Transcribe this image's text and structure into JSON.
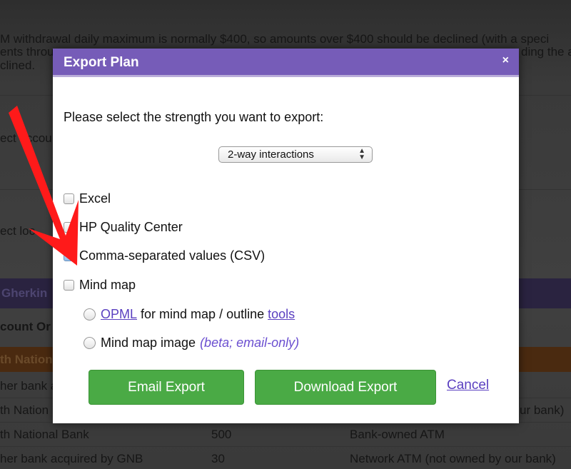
{
  "background": {
    "lines": [
      "M withdrawal daily maximum is normally $400, so amounts over $400 should be declined (with a speci",
      "ents throug",
      "ding the a",
      "clined.",
      "ect accou",
      "ect loc",
      "Gherkin",
      "count Or",
      "th Nation",
      "her bank a",
      "th Nation",
      "ur bank)"
    ],
    "rows": [
      {
        "bank": "th National Bank",
        "amount": "500",
        "atm": "Bank-owned ATM"
      },
      {
        "bank": "her bank acquired by GNB",
        "amount": "30",
        "atm": "Network ATM (not owned by our bank)"
      }
    ]
  },
  "modal": {
    "title": "Export Plan",
    "close": "×",
    "prompt": "Please select the strength you want to export:",
    "strength": {
      "selected": "2-way interactions"
    },
    "options": [
      {
        "label": "Excel",
        "checked": false
      },
      {
        "label": "HP Quality Center",
        "checked": false
      },
      {
        "label": "Comma-separated values (CSV)",
        "checked": true
      },
      {
        "label": "Mind map",
        "checked": false
      }
    ],
    "mindmap": {
      "opml_link": "OPML",
      "opml_text": "for mind map / outline",
      "tools_link": "tools",
      "image_text": "Mind map image",
      "image_note": "(beta; email-only)"
    },
    "buttons": {
      "email": "Email Export",
      "download": "Download Export",
      "cancel": "Cancel"
    }
  },
  "colors": {
    "header": "#765cb8",
    "button": "#4aaa45",
    "link": "#5a3fc0",
    "arrow": "#ff1a1a"
  }
}
